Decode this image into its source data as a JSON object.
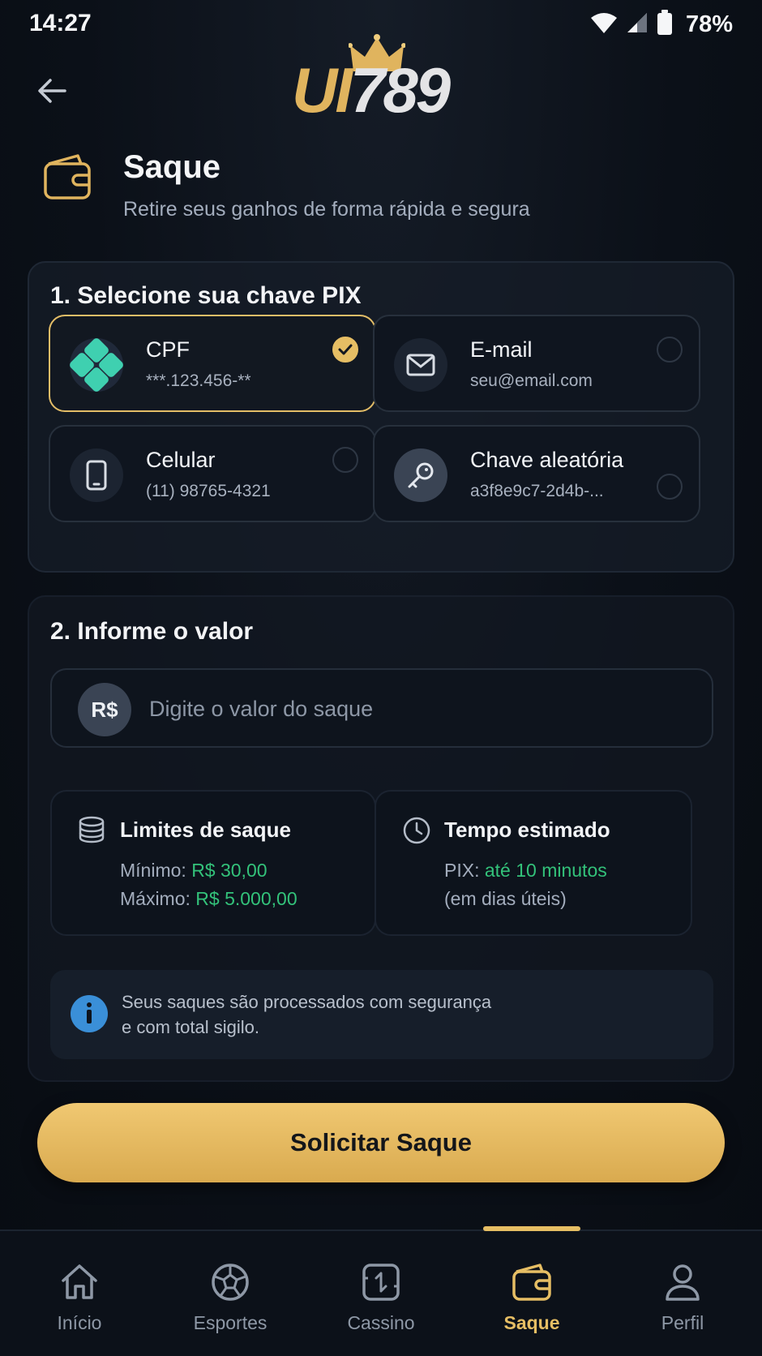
{
  "status_bar": {
    "time": "14:27",
    "battery": "78%"
  },
  "logo": {
    "part1": "UI",
    "part2": "789"
  },
  "header": {
    "title": "Saque",
    "subtitle": "Retire seus ganhos de forma rápida e segura"
  },
  "pix_section": {
    "title": "1. Selecione sua chave PIX",
    "options": [
      {
        "label": "CPF",
        "value": "***.123.456-**",
        "selected": true,
        "icon": "pix-icon"
      },
      {
        "label": "E-mail",
        "value": "seu@email.com",
        "selected": false,
        "icon": "mail-icon"
      },
      {
        "label": "Celular",
        "value": "(11) 98765-4321",
        "selected": false,
        "icon": "phone-icon"
      },
      {
        "label": "Chave aleatória",
        "value": "a3f8e9c7-2d4b-...",
        "selected": false,
        "icon": "key-icon"
      }
    ]
  },
  "amount_section": {
    "title": "2. Informe o valor",
    "currency": "R$",
    "placeholder": "Digite o valor do saque",
    "limits": {
      "title": "Limites de saque",
      "min_label": "Mínimo:",
      "min_value": "R$ 30,00",
      "max_label": "Máximo:",
      "max_value": "R$ 5.000,00"
    },
    "time": {
      "title": "Tempo estimado",
      "pix_label": "PIX:",
      "pix_value": "até 10 minutos",
      "note": "(em dias úteis)"
    },
    "notice_line1": "Seus saques são processados com segurança",
    "notice_line2": "e com total sigilo."
  },
  "submit_label": "Solicitar Saque",
  "nav": {
    "items": [
      {
        "label": "Início",
        "icon": "home-icon",
        "active": false
      },
      {
        "label": "Esportes",
        "icon": "soccer-ball-icon",
        "active": false
      },
      {
        "label": "Cassino",
        "icon": "casino-icon",
        "active": false
      },
      {
        "label": "Saque",
        "icon": "wallet-icon",
        "active": true
      },
      {
        "label": "Perfil",
        "icon": "user-icon",
        "active": false
      }
    ]
  },
  "colors": {
    "accent": "#e6be64",
    "green": "#33c27a",
    "background": "#0a0f17"
  }
}
